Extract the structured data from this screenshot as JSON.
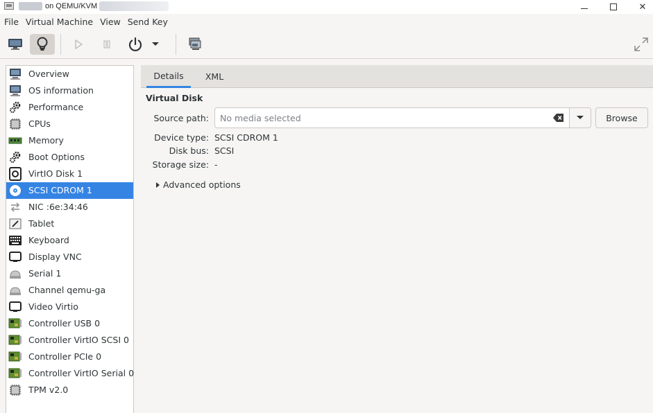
{
  "window": {
    "title": "on QEMU/KVM",
    "minimize_icon": "minimize-icon",
    "maximize_icon": "maximize-icon",
    "close_glyph": "✕"
  },
  "menu": [
    "File",
    "Virtual Machine",
    "View",
    "Send Key"
  ],
  "toolbar": {
    "buttons": [
      {
        "name": "console-button",
        "icon": "monitor-icon"
      },
      {
        "name": "details-button",
        "icon": "lightbulb-icon",
        "active": true
      },
      {
        "name": "run-button",
        "icon": "play-icon",
        "disabled": true
      },
      {
        "name": "pause-button",
        "icon": "pause-icon",
        "disabled": true
      },
      {
        "name": "power-button",
        "icon": "power-icon"
      },
      {
        "name": "power-menu-button",
        "icon": "chevron-down-icon"
      },
      {
        "name": "snapshots-button",
        "icon": "snapshots-icon"
      },
      {
        "name": "fullscreen-button",
        "icon": "fullscreen-icon"
      }
    ]
  },
  "hardware_list": [
    {
      "label": "Overview",
      "icon": "monitor-icon"
    },
    {
      "label": "OS information",
      "icon": "monitor-icon"
    },
    {
      "label": "Performance",
      "icon": "gears-icon"
    },
    {
      "label": "CPUs",
      "icon": "chip-icon"
    },
    {
      "label": "Memory",
      "icon": "memory-icon"
    },
    {
      "label": "Boot Options",
      "icon": "gears-icon"
    },
    {
      "label": "VirtIO Disk 1",
      "icon": "disk-icon"
    },
    {
      "label": "SCSI CDROM 1",
      "icon": "cdrom-icon",
      "selected": true
    },
    {
      "label": "NIC :6e:34:46",
      "icon": "network-icon"
    },
    {
      "label": "Tablet",
      "icon": "tablet-icon"
    },
    {
      "label": "Keyboard",
      "icon": "keyboard-icon"
    },
    {
      "label": "Display VNC",
      "icon": "display-icon"
    },
    {
      "label": "Serial 1",
      "icon": "serial-icon"
    },
    {
      "label": "Channel qemu-ga",
      "icon": "serial-icon"
    },
    {
      "label": "Video Virtio",
      "icon": "display-icon"
    },
    {
      "label": "Controller USB 0",
      "icon": "card-icon"
    },
    {
      "label": "Controller VirtIO SCSI 0",
      "icon": "card-icon"
    },
    {
      "label": "Controller PCIe 0",
      "icon": "card-icon"
    },
    {
      "label": "Controller VirtIO Serial 0",
      "icon": "card-icon"
    },
    {
      "label": "TPM v2.0",
      "icon": "chip-icon"
    }
  ],
  "tabs": {
    "details": "Details",
    "xml": "XML"
  },
  "section_title": "Virtual Disk",
  "source": {
    "label": "Source path:",
    "value": "",
    "placeholder": "No media selected",
    "browse_label": "Browse"
  },
  "fields": {
    "device_type_label": "Device type:",
    "device_type_value": "SCSI CDROM 1",
    "disk_bus_label": "Disk bus:",
    "disk_bus_value": "SCSI",
    "storage_size_label": "Storage size:",
    "storage_size_value": "-"
  },
  "advanced_options": "Advanced options",
  "colors": {
    "selection": "#3584e4",
    "background": "#f6f5f4"
  }
}
